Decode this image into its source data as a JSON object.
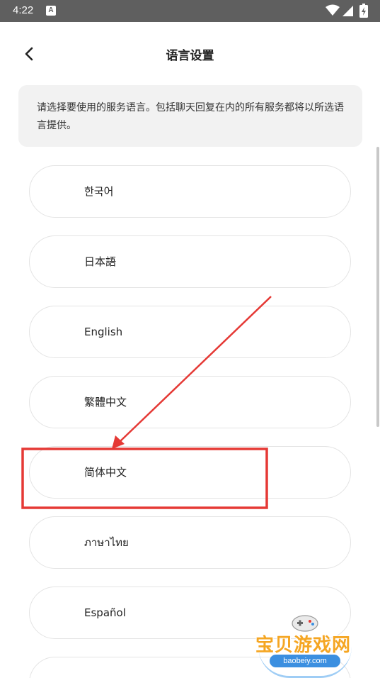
{
  "status_bar": {
    "time": "4:22",
    "notification_icon": "A"
  },
  "header": {
    "title": "语言设置",
    "back_icon": "chevron-left-icon"
  },
  "notice": {
    "text": "请选择要使用的服务语言。包括聊天回复在内的所有服务都将以所选语言提供。"
  },
  "languages": [
    {
      "label": "한국어"
    },
    {
      "label": "日本語"
    },
    {
      "label": "English"
    },
    {
      "label": "繁體中文"
    },
    {
      "label": "简体中文",
      "highlighted": true
    },
    {
      "label": "ภาษาไทย"
    },
    {
      "label": "Español"
    },
    {
      "label": ""
    }
  ],
  "annotation": {
    "color": "#e53935",
    "highlight_target": "简体中文"
  },
  "watermark": {
    "title": "宝贝游戏网",
    "url": "baobeiy.com"
  }
}
